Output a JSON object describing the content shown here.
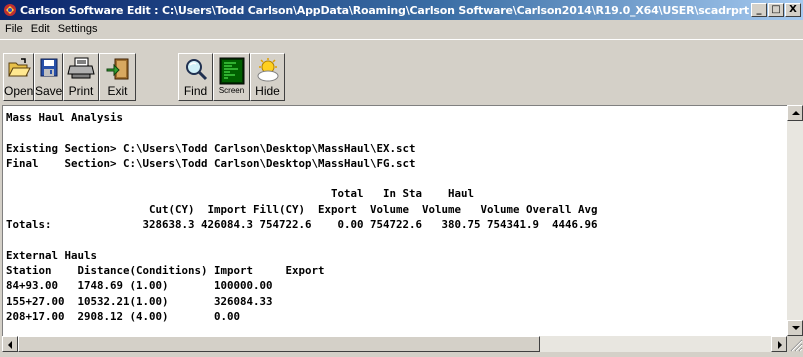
{
  "window": {
    "title": "Carlson Software Edit : C:\\Users\\Todd Carlson\\AppData\\Roaming\\Carlson Software\\Carlson2014\\R19.0_X64\\USER\\scadrprt.tmp",
    "minimize_glyph": "_",
    "maximize_glyph": "□",
    "close_glyph": "X"
  },
  "menu": {
    "file": "File",
    "edit": "Edit",
    "settings": "Settings"
  },
  "toolbar": {
    "open": "Open",
    "save": "Save",
    "print": "Print",
    "exit": "Exit",
    "find": "Find",
    "screen": "Screen",
    "hide": "Hide"
  },
  "report": {
    "lines": [
      "Mass Haul Analysis",
      "",
      "Existing Section> C:\\Users\\Todd Carlson\\Desktop\\MassHaul\\EX.sct",
      "Final    Section> C:\\Users\\Todd Carlson\\Desktop\\MassHaul\\FG.sct",
      "",
      "                                                  Total   In Sta    Haul",
      "                      Cut(CY)  Import Fill(CY)  Export  Volume  Volume   Volume Overall Avg",
      "Totals:              328638.3 426084.3 754722.6    0.00 754722.6   380.75 754341.9  4446.96",
      "",
      "External Hauls",
      "Station    Distance(Conditions) Import     Export",
      "84+93.00   1748.69 (1.00)       100000.00",
      "155+27.00  10532.21(1.00)       326084.33",
      "208+17.00  2908.12 (4.00)       0.00"
    ]
  },
  "colors": {
    "title_start": "#0a246a",
    "title_end": "#a6caf0",
    "face": "#d4d0c8",
    "report_bg": "#ffffff"
  }
}
